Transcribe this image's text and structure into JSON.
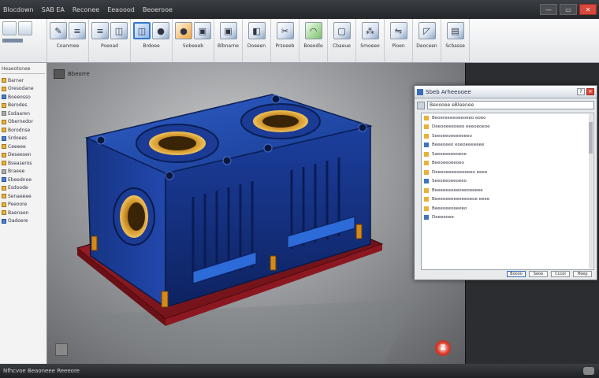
{
  "window": {
    "menu": [
      "Blocdown",
      "SAB EA",
      "Reconee",
      "Eeaoood",
      "Beoerooe"
    ],
    "minimize": "—",
    "maximize": "▭",
    "close": "✕"
  },
  "ribbon": {
    "groups": [
      {
        "label": "Coanmee",
        "icons": [
          "pencil-icon",
          "lines-icon"
        ]
      },
      {
        "label": "Poeoad",
        "icons": [
          "sketch-icon",
          "sphere-icon"
        ]
      },
      {
        "label": "Brdoee",
        "icons": [
          "part-icon",
          "extrude-icon"
        ]
      },
      {
        "label": "Sobeeeb",
        "icons": [
          "cut-icon",
          "fillet-icon"
        ]
      },
      {
        "label": "Blbnarne",
        "icons": [
          "shell-icon"
        ]
      },
      {
        "label": "Doeeen",
        "icons": [
          "pattern-icon"
        ]
      },
      {
        "label": "Prsoeeb",
        "icons": [
          "mirror-icon"
        ]
      },
      {
        "label": "Boeodle",
        "icons": [
          "draft-icon"
        ]
      },
      {
        "label": "Cbaeue",
        "icons": [
          "rib-icon"
        ]
      },
      {
        "label": "Smoeeo",
        "icons": [
          "assembly-icon"
        ]
      },
      {
        "label": "Pioen",
        "icons": [
          "drawing-icon"
        ]
      },
      {
        "label": "Deoceen",
        "icons": [
          "render-icon"
        ]
      },
      {
        "label": "Scbasse",
        "icons": [
          "options-icon"
        ]
      }
    ]
  },
  "tree": {
    "header": "Heaeotonee",
    "items": [
      "Barner",
      "Oresodane",
      "Boeeosso",
      "Berodes",
      "Esdaaren",
      "Obernedor",
      "Borodnse",
      "Srdoees",
      "Ceeeee",
      "Deseesen",
      "Bseaseros",
      "Braeee",
      "Ebeednoe",
      "Esdoode",
      "Senaeeee",
      "Peeoore",
      "Baenaen",
      "Oadoere"
    ]
  },
  "viewport": {
    "title": "Bbeorre",
    "orientation_label": "Z"
  },
  "dialog": {
    "title": "Sbeb Arheeooee",
    "search_value": "Beoooee eBleenee",
    "rows": [
      "Beoereeeeoeeoeeo eoeo",
      "Deeoeeeeoeeo eeeoeoeoe",
      "Seeoeeoeeeeeeeo",
      "Beeeoeeo eoeoeeeeeee",
      "Saeeeeeeeoeoe",
      "Beeoeeoeeoeo",
      "Deeeoeeeeoeoeeeo eeee",
      "Seeoeeoeeoeeo",
      "Beeeeeeoeeoeeoeeeee",
      "Beeeoeeeeeeeeoeoe eeee",
      "Beeeoeeoeeeeo",
      "Deeeeoee"
    ],
    "buttons": [
      "Boooo",
      "Seoe",
      "Cccel",
      "Heep"
    ]
  },
  "status": {
    "text": "Nfhcvoe Beaoneee Reeeore"
  }
}
